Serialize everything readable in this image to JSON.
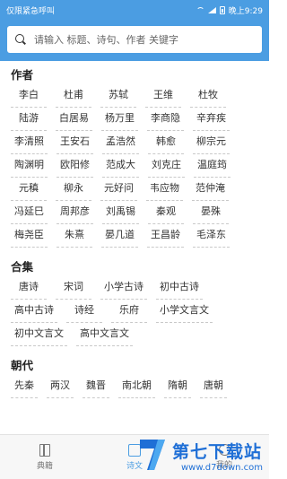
{
  "status_bar": {
    "left_text": "仅限紧急呼叫",
    "time": "晚上9:29"
  },
  "search": {
    "placeholder": "请输入 标题、诗句、作者 关键字"
  },
  "authors": {
    "title": "作者",
    "items": [
      "李白",
      "杜甫",
      "苏轼",
      "王维",
      "杜牧",
      "陆游",
      "白居易",
      "杨万里",
      "李商隐",
      "辛弃疾",
      "李清照",
      "王安石",
      "孟浩然",
      "韩愈",
      "柳宗元",
      "陶渊明",
      "欧阳修",
      "范成大",
      "刘克庄",
      "温庭筠",
      "元稹",
      "柳永",
      "元好问",
      "韦应物",
      "范仲淹",
      "冯延巳",
      "周邦彦",
      "刘禹锡",
      "秦观",
      "晏殊",
      "梅尧臣",
      "朱熹",
      "晏几道",
      "王昌龄",
      "毛泽东"
    ]
  },
  "collections": {
    "title": "合集",
    "items": [
      "唐诗",
      "宋词",
      "小学古诗",
      "初中古诗",
      "高中古诗",
      "诗经",
      "乐府",
      "小学文言文",
      "初中文言文",
      "高中文言文"
    ]
  },
  "dynasties": {
    "title": "朝代",
    "items": [
      "先秦",
      "两汉",
      "魏晋",
      "南北朝",
      "隋朝",
      "唐朝"
    ]
  },
  "bottom_nav": {
    "items": [
      {
        "label": "典籍",
        "icon": "book-icon"
      },
      {
        "label": "诗文",
        "icon": "poem-icon"
      },
      {
        "label": "我的",
        "icon": "profile-icon"
      }
    ]
  },
  "watermark": {
    "text": "第七下载站",
    "url": "www.d7down.com"
  },
  "colors": {
    "primary": "#4b9de2",
    "watermark": "#1f6fd6"
  }
}
